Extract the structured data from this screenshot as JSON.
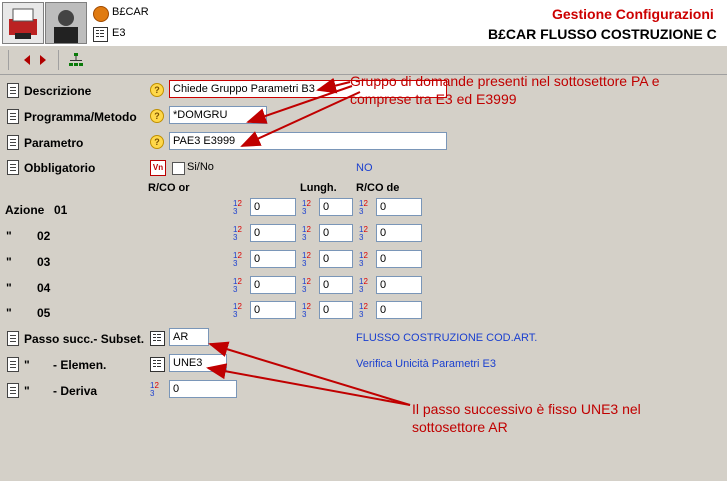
{
  "header": {
    "app_name": "B£CAR",
    "sub_code": "E3",
    "title_red": "Gestione Configurazioni",
    "title_main": "B£CAR FLUSSO COSTRUZIONE C"
  },
  "form": {
    "descrizione": {
      "label": "Descrizione",
      "value": "Chiede Gruppo Parametri  B3"
    },
    "programma": {
      "label": "Programma/Metodo",
      "value": "*DOMGRU"
    },
    "parametro": {
      "label": "Parametro",
      "value": "PAE3  E3999"
    },
    "obbligatorio": {
      "label": "Obbligatorio",
      "checkbox_label": "Si/No",
      "status": "NO"
    },
    "col_headers": {
      "rco_or": "R/CO or",
      "lungh": "Lungh.",
      "rco_de": "R/CO de"
    },
    "azioni": {
      "label": "Azione",
      "rows": [
        {
          "prefix": "",
          "num": "01",
          "rco_or": "0",
          "lungh": "0",
          "rco_de": "0"
        },
        {
          "prefix": "\"",
          "num": "02",
          "rco_or": "0",
          "lungh": "0",
          "rco_de": "0"
        },
        {
          "prefix": "\"",
          "num": "03",
          "rco_or": "0",
          "lungh": "0",
          "rco_de": "0"
        },
        {
          "prefix": "\"",
          "num": "04",
          "rco_or": "0",
          "lungh": "0",
          "rco_de": "0"
        },
        {
          "prefix": "\"",
          "num": "05",
          "rco_or": "0",
          "lungh": "0",
          "rco_de": "0"
        }
      ]
    },
    "passo_subset": {
      "label": "Passo succ.- Subset.",
      "value": "AR",
      "desc": "FLUSSO COSTRUZIONE COD.ART."
    },
    "elemen": {
      "label": "\"       - Elemen.",
      "value": "UNE3",
      "desc": "Verifica Unicità Parametri E3"
    },
    "deriva": {
      "label": "\"       - Deriva",
      "value": "0"
    }
  },
  "icons": [
    "app-icon",
    "document-icon",
    "help-icon",
    "list-icon",
    "number-icon",
    "back-arrow-icon",
    "forward-arrow-icon",
    "tree-icon"
  ],
  "annotations": {
    "top_note": "Gruppo di domande presenti nel sottosettore PA e comprese tra E3 ed E3999",
    "bottom_note": "Il passo successivo è fisso UNE3 nel sottosettore AR"
  },
  "colors": {
    "note_red": "#c00000",
    "link_blue": "#1a3fcf",
    "title_red": "#cc0000"
  }
}
